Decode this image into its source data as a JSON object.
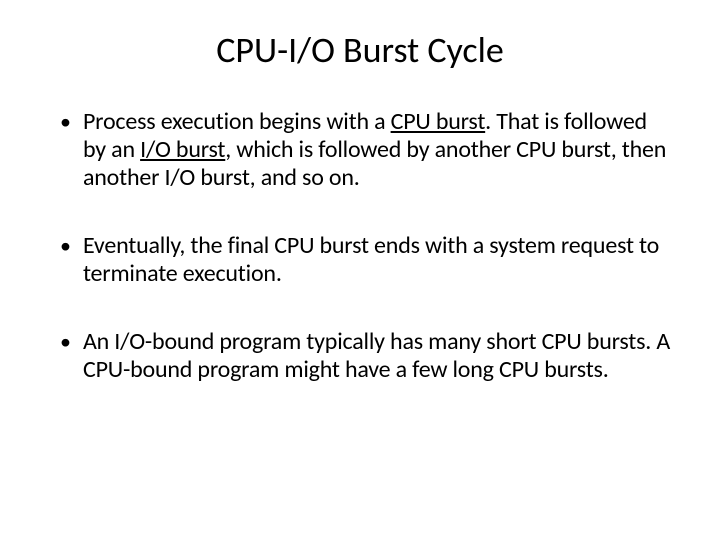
{
  "slide": {
    "title": "CPU-I/O Burst Cycle",
    "bullets": {
      "b1_pre": "Process execution begins with a ",
      "b1_u1": "CPU burst",
      "b1_mid1": ". That is followed by an ",
      "b1_u2": "I/O burst",
      "b1_post": ", which is followed by another CPU burst, then another I/O burst, and so on.",
      "b2": "Eventually, the final CPU burst ends with a system request to terminate execution.",
      "b3": "An I/O-bound program typically has many short CPU bursts. A CPU-bound program might have a few long CPU bursts."
    },
    "marker": "•"
  }
}
